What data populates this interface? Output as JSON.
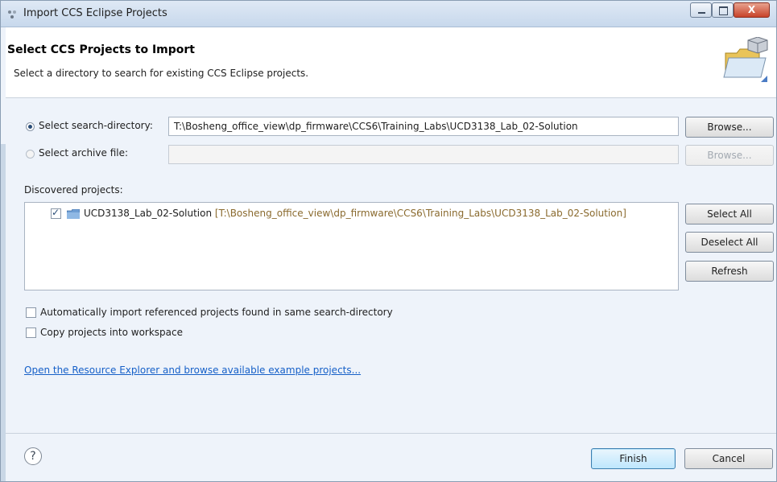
{
  "window": {
    "title": "Import CCS Eclipse Projects",
    "controls": {
      "minimize_icon": "minimize-icon",
      "maximize_icon": "maximize-icon",
      "close_label": "X"
    }
  },
  "header": {
    "title": "Select CCS Projects to Import",
    "description": "Select a directory to search for existing CCS Eclipse projects.",
    "icon": "wizard-folder-icon"
  },
  "search_directory": {
    "label": "Select search-directory:",
    "selected": true,
    "value": "T:\\Bosheng_office_view\\dp_firmware\\CCS6\\Training_Labs\\UCD3138_Lab_02-Solution",
    "browse_label": "Browse..."
  },
  "archive_file": {
    "label": "Select archive file:",
    "selected": false,
    "value": "",
    "browse_label": "Browse...",
    "enabled": false
  },
  "discovered": {
    "label": "Discovered projects:",
    "projects": [
      {
        "checked": true,
        "name": "UCD3138_Lab_02-Solution",
        "path": "[T:\\Bosheng_office_view\\dp_firmware\\CCS6\\Training_Labs\\UCD3138_Lab_02-Solution]"
      }
    ],
    "buttons": {
      "select_all": "Select All",
      "deselect_all": "Deselect All",
      "refresh": "Refresh"
    }
  },
  "options": {
    "auto_import": {
      "label": "Automatically import referenced projects found in same search-directory",
      "checked": false
    },
    "copy_projects": {
      "label": "Copy projects into workspace",
      "checked": false
    }
  },
  "resource_link": "Open the Resource Explorer and browse available example projects...",
  "footer": {
    "help": "?",
    "finish": "Finish",
    "cancel": "Cancel"
  },
  "colors": {
    "link": "#1660c8",
    "project_path": "#8a6a2e",
    "default_button": "#bee6fd"
  }
}
